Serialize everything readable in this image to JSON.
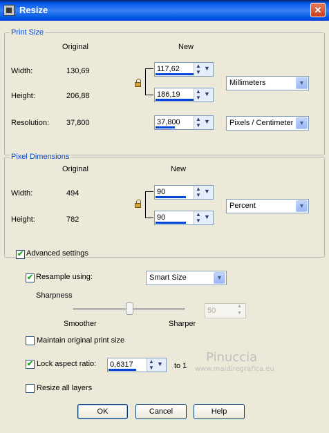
{
  "window": {
    "title": "Resize",
    "close_glyph": "✕"
  },
  "print_size": {
    "title": "Print Size",
    "col_original": "Original",
    "col_new": "New",
    "width_label": "Width:",
    "width_original": "130,69",
    "width_new": "117,62",
    "height_label": "Height:",
    "height_original": "206,88",
    "height_new": "186,19",
    "resolution_label": "Resolution:",
    "resolution_original": "37,800",
    "resolution_new": "37,800",
    "unit": "Millimeters",
    "res_unit": "Pixels / Centimeter"
  },
  "pixel_dims": {
    "title": "Pixel Dimensions",
    "col_original": "Original",
    "col_new": "New",
    "width_label": "Width:",
    "width_original": "494",
    "width_new": "90",
    "height_label": "Height:",
    "height_original": "782",
    "height_new": "90",
    "unit": "Percent"
  },
  "advanced": {
    "label": "Advanced settings",
    "checked": true,
    "resample_label": "Resample using:",
    "resample_checked": true,
    "resample_value": "Smart Size",
    "sharpness_label": "Sharpness",
    "smoother_label": "Smoother",
    "sharper_label": "Sharper",
    "sharpness_value": "50",
    "maintain_label": "Maintain original print size",
    "maintain_checked": false,
    "lock_label": "Lock aspect ratio:",
    "lock_checked": true,
    "lock_value": "0,6317",
    "to1_label": "to 1",
    "resize_layers_label": "Resize all layers",
    "resize_layers_checked": false
  },
  "buttons": {
    "ok": "OK",
    "cancel": "Cancel",
    "help": "Help"
  },
  "watermark": {
    "name": "Pinuccia",
    "url": "www.maidiregrafica.eu"
  },
  "icons": {
    "app": "resize-app-icon",
    "close": "close-icon",
    "lock": "padlock-icon",
    "spin_up": "▲",
    "spin_down": "▼",
    "dropdown": "▼",
    "check": "✔"
  },
  "colors": {
    "title_bar": "#0058ee",
    "group_title": "#0046d5",
    "dialog_bg": "#ece9d8",
    "accent_bar": "#0046d5"
  }
}
